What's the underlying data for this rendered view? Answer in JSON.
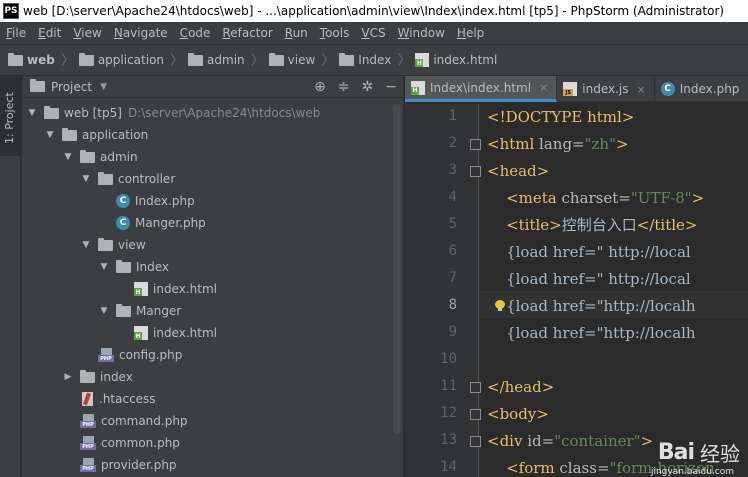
{
  "window": {
    "logo": "PS",
    "title": "web [D:\\server\\Apache24\\htdocs\\web] - ...\\application\\admin\\view\\Index\\index.html [tp5] - PhpStorm (Administrator)"
  },
  "menu": {
    "items": [
      {
        "mnemonic": "F",
        "rest": "ile"
      },
      {
        "mnemonic": "E",
        "rest": "dit"
      },
      {
        "mnemonic": "V",
        "rest": "iew"
      },
      {
        "mnemonic": "N",
        "rest": "avigate"
      },
      {
        "mnemonic": "C",
        "rest": "ode"
      },
      {
        "mnemonic": "R",
        "rest": "efactor"
      },
      {
        "mnemonic": "R",
        "rest": "un"
      },
      {
        "mnemonic": "T",
        "rest": "ools"
      },
      {
        "mnemonic": "V",
        "rest": "CS"
      },
      {
        "mnemonic": "W",
        "rest": "indow"
      },
      {
        "mnemonic": "H",
        "rest": "elp"
      }
    ]
  },
  "breadcrumb": [
    "web",
    "application",
    "admin",
    "view",
    "Index",
    "index.html"
  ],
  "toolstrip": {
    "project_label": "1: Project"
  },
  "project_panel": {
    "title": "Project",
    "tree": [
      {
        "depth": 0,
        "arrow": "open",
        "icon": "folder-icon",
        "name": "web [tp5]",
        "path": "D:\\server\\Apache24\\htdocs\\web"
      },
      {
        "depth": 1,
        "arrow": "open",
        "icon": "folder-icon",
        "name": "application"
      },
      {
        "depth": 2,
        "arrow": "open",
        "icon": "folder-icon",
        "name": "admin"
      },
      {
        "depth": 3,
        "arrow": "open",
        "icon": "folder-icon",
        "name": "controller"
      },
      {
        "depth": 4,
        "arrow": "none",
        "icon": "php-class-icon",
        "name": "Index.php"
      },
      {
        "depth": 4,
        "arrow": "none",
        "icon": "php-class-icon",
        "name": "Manger.php"
      },
      {
        "depth": 3,
        "arrow": "open",
        "icon": "folder-icon",
        "name": "view"
      },
      {
        "depth": 4,
        "arrow": "open",
        "icon": "folder-icon",
        "name": "Index"
      },
      {
        "depth": 5,
        "arrow": "none",
        "icon": "html-file-icon",
        "name": "index.html"
      },
      {
        "depth": 4,
        "arrow": "open",
        "icon": "folder-icon",
        "name": "Manger"
      },
      {
        "depth": 5,
        "arrow": "none",
        "icon": "html-file-icon",
        "name": "index.html"
      },
      {
        "depth": 3,
        "arrow": "none",
        "icon": "php-file-icon",
        "name": "config.php"
      },
      {
        "depth": 2,
        "arrow": "closed",
        "icon": "folder-icon",
        "name": "index"
      },
      {
        "depth": 2,
        "arrow": "none",
        "icon": "htaccess-icon",
        "name": ".htaccess"
      },
      {
        "depth": 2,
        "arrow": "none",
        "icon": "php-file-icon",
        "name": "command.php"
      },
      {
        "depth": 2,
        "arrow": "none",
        "icon": "php-file-icon",
        "name": "common.php"
      },
      {
        "depth": 2,
        "arrow": "none",
        "icon": "php-file-icon",
        "name": "provider.php"
      }
    ]
  },
  "editor": {
    "tabs": [
      {
        "icon": "html-file-icon",
        "label": "Index\\index.html",
        "active": true
      },
      {
        "icon": "js-file-icon",
        "label": "index.js",
        "active": false
      },
      {
        "icon": "php-class-icon",
        "label": "Index.php",
        "active": false
      }
    ],
    "current_line": 8,
    "lines": [
      {
        "n": "1",
        "parts": [
          [
            "tag",
            "<!DOCTYPE html>"
          ]
        ]
      },
      {
        "n": "2",
        "parts": [
          [
            "tag",
            "<html "
          ],
          [
            "att",
            "lang="
          ],
          [
            "val",
            "\"zh\""
          ],
          [
            "tag",
            ">"
          ]
        ]
      },
      {
        "n": "3",
        "parts": [
          [
            "tag",
            "<head>"
          ]
        ]
      },
      {
        "n": "4",
        "parts": [
          [
            "txtc",
            "    "
          ],
          [
            "tag",
            "<meta "
          ],
          [
            "att",
            "charset="
          ],
          [
            "val",
            "\"UTF-8\""
          ],
          [
            "tag",
            ">"
          ]
        ]
      },
      {
        "n": "5",
        "parts": [
          [
            "txtc",
            "    "
          ],
          [
            "tag",
            "<title>"
          ],
          [
            "txtc",
            "控制台入口"
          ],
          [
            "tag",
            "</title>"
          ]
        ]
      },
      {
        "n": "6",
        "parts": [
          [
            "txtc",
            "    {load href=\" http://local"
          ]
        ]
      },
      {
        "n": "7",
        "parts": [
          [
            "txtc",
            "    {load href=\" http://local"
          ]
        ]
      },
      {
        "n": "8",
        "parts": [
          [
            "txtc",
            "    {load href=\"http://localh"
          ]
        ]
      },
      {
        "n": "9",
        "parts": [
          [
            "txtc",
            "    {load href=\"http://localh"
          ]
        ]
      },
      {
        "n": "10",
        "parts": [
          [
            "txtc",
            ""
          ]
        ]
      },
      {
        "n": "11",
        "parts": [
          [
            "tag",
            "</head>"
          ]
        ]
      },
      {
        "n": "12",
        "parts": [
          [
            "tag",
            "<body>"
          ]
        ]
      },
      {
        "n": "13",
        "parts": [
          [
            "tag",
            "<div "
          ],
          [
            "att",
            "id="
          ],
          [
            "val",
            "\"container\""
          ],
          [
            "tag",
            ">"
          ]
        ]
      },
      {
        "n": "14",
        "parts": [
          [
            "txtc",
            "    "
          ],
          [
            "tag",
            "<form "
          ],
          [
            "att",
            "class="
          ],
          [
            "val",
            "\"form-horizon"
          ]
        ]
      }
    ]
  },
  "watermark": {
    "logo": "Bai",
    "text": "经验",
    "url": "jingyan.baidu.com"
  }
}
